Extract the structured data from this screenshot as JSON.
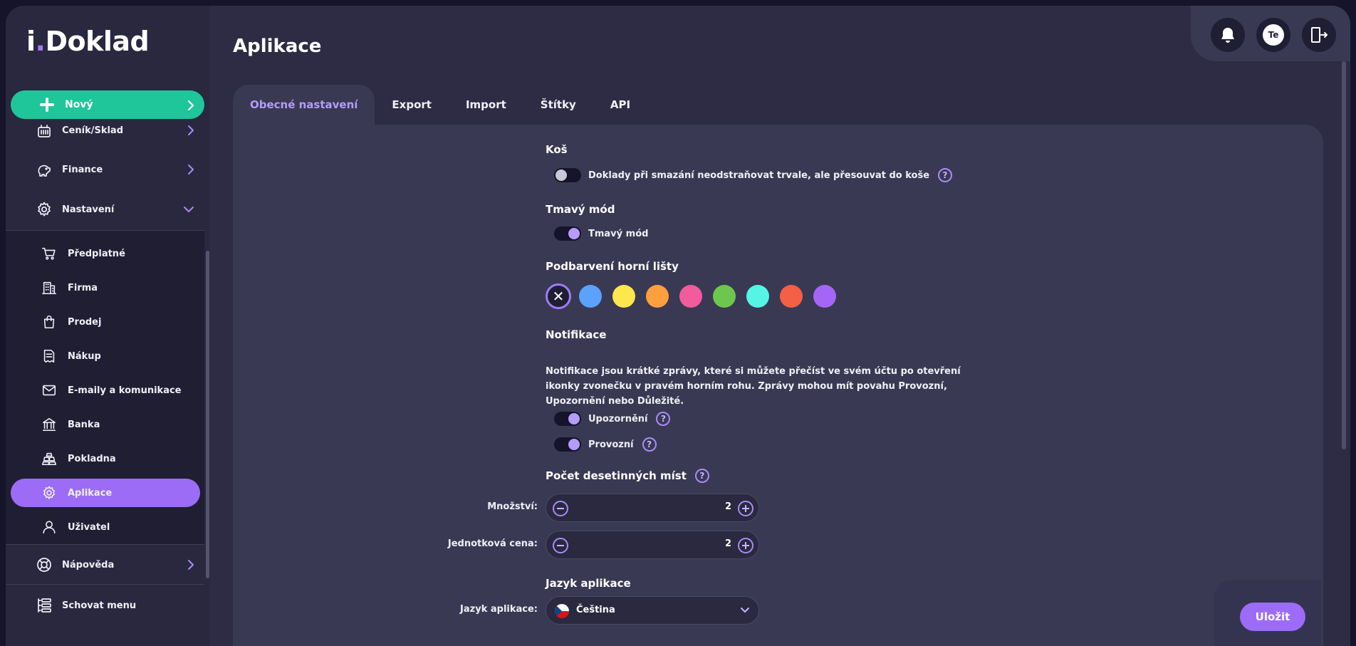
{
  "brand": {
    "logo_text_1": "i",
    "logo_text_2": "Doklad"
  },
  "sidebar": {
    "new_button": "Nový",
    "top_items": [
      {
        "label": "Ceník/Sklad",
        "icon": "barcode-box-icon"
      },
      {
        "label": "Finance",
        "icon": "piggy-bank-icon"
      },
      {
        "label": "Nastavení",
        "icon": "gear-icon"
      }
    ],
    "sub_items": [
      {
        "label": "Předplatné",
        "icon": "cart-icon"
      },
      {
        "label": "Firma",
        "icon": "building-icon"
      },
      {
        "label": "Prodej",
        "icon": "shopping-bag-icon"
      },
      {
        "label": "Nákup",
        "icon": "receipt-icon"
      },
      {
        "label": "E-maily a komunikace",
        "icon": "envelope-icon"
      },
      {
        "label": "Banka",
        "icon": "bank-icon"
      },
      {
        "label": "Pokladna",
        "icon": "coins-icon"
      },
      {
        "label": "Aplikace",
        "icon": "gear-icon",
        "active": true
      },
      {
        "label": "Uživatel",
        "icon": "user-icon"
      }
    ],
    "help": "Nápověda",
    "hide_menu": "Schovat menu"
  },
  "header": {
    "title": "Aplikace",
    "avatar_initials": "Te"
  },
  "tabs": [
    "Obecné nastavení",
    "Export",
    "Import",
    "Štítky",
    "API"
  ],
  "settings": {
    "trash": {
      "title": "Koš",
      "toggle_label": "Doklady při smazání neodstraňovat trvale, ale přesouvat do koše",
      "enabled": false
    },
    "dark_mode": {
      "title": "Tmavý mód",
      "toggle_label": "Tmavý mód",
      "enabled": true
    },
    "header_color": {
      "title": "Podbarvení horní lišty",
      "swatches": [
        "#5aa2fb",
        "#fde74c",
        "#fd9e3f",
        "#f25b9c",
        "#6ec74d",
        "#54f5e4",
        "#f55f45",
        "#a566f7"
      ],
      "selected": "none"
    },
    "notifications": {
      "title": "Notifikace",
      "description": "Notifikace jsou krátké zprávy, které si můžete přečíst ve svém účtu po otevření ikonky zvonečku v pravém horním rohu. Zprávy mohou mít povahu Provozní, Upozornění nebo Důležité.",
      "warning_label": "Upozornění",
      "warning_enabled": true,
      "operational_label": "Provozní",
      "operational_enabled": true
    },
    "decimals": {
      "title": "Počet desetinných míst",
      "quantity_label": "Množství:",
      "quantity_value": "2",
      "unit_price_label": "Jednotková cena:",
      "unit_price_value": "2"
    },
    "language": {
      "title": "Jazyk aplikace",
      "label": "Jazyk aplikace:",
      "value": "Čeština"
    }
  },
  "actions": {
    "save": "Uložit"
  },
  "colors": {
    "accent": "#9c6cf6",
    "new_button": "#1fc69a",
    "background": "#2d2c44"
  }
}
